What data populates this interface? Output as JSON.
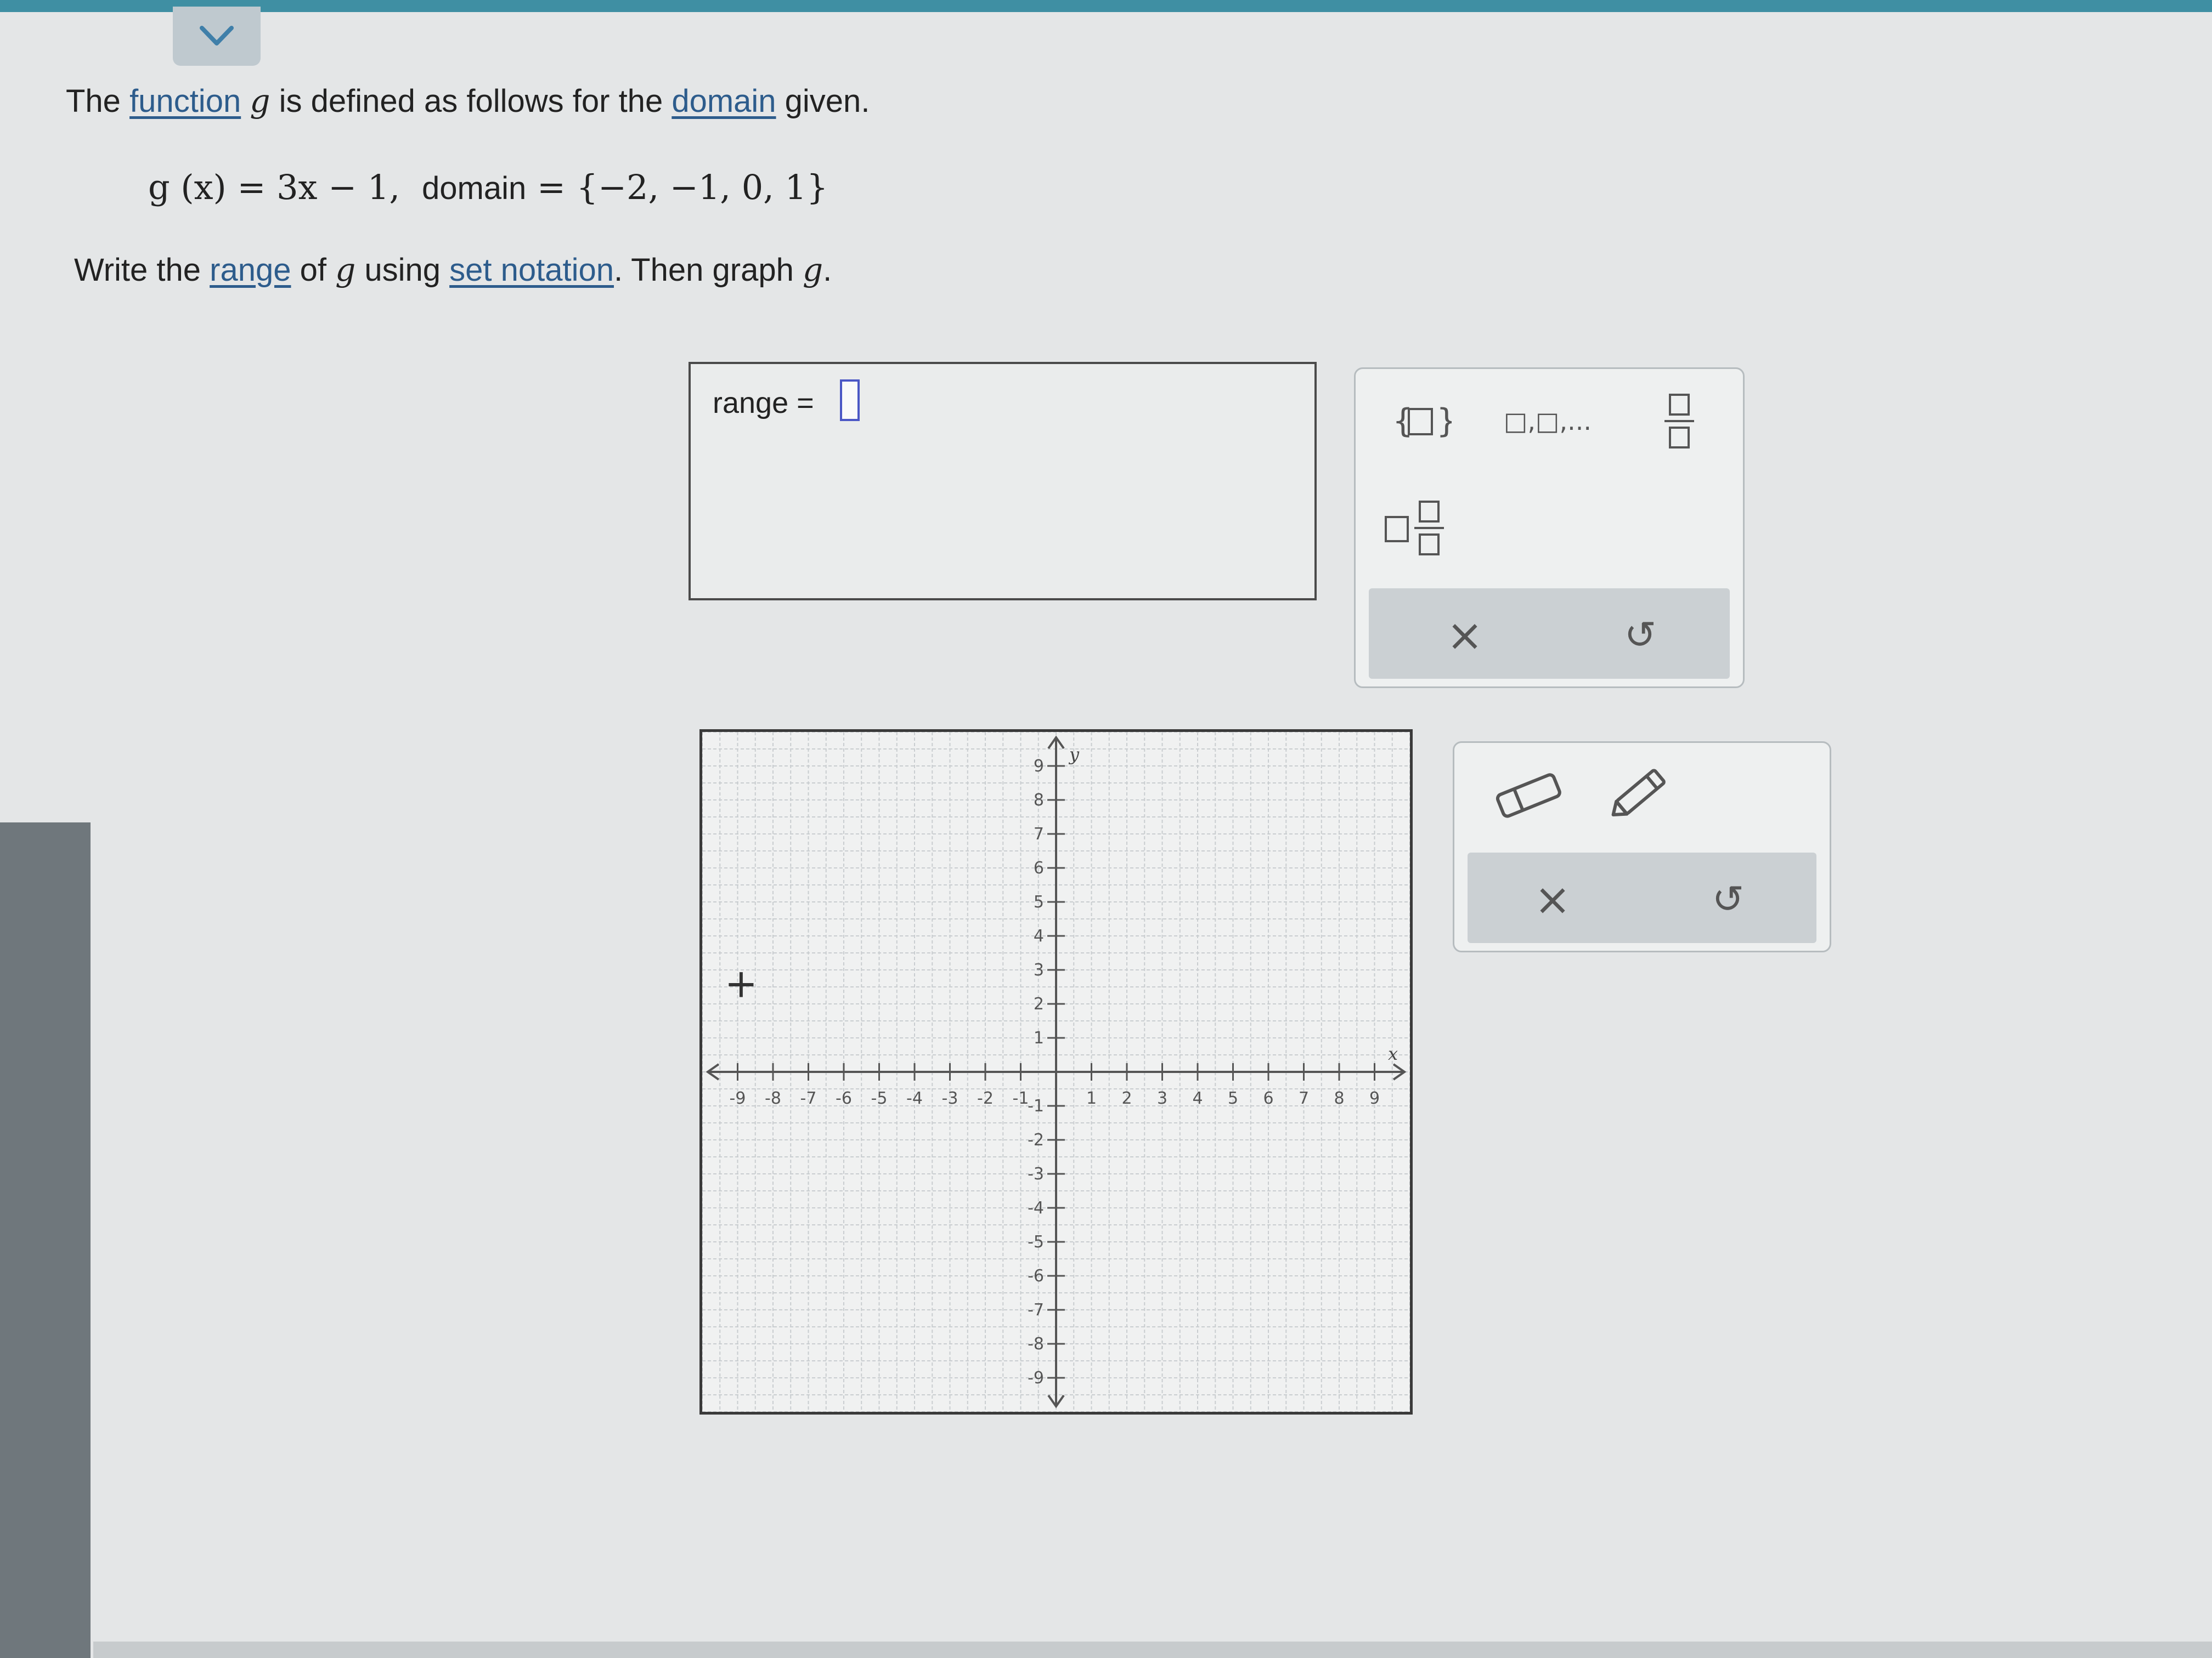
{
  "problem": {
    "line1": {
      "pre": "The ",
      "function_link": "function",
      "g": "g",
      "mid": " is defined as follows for the ",
      "domain_link": "domain",
      "post": " given."
    },
    "line2": {
      "formula": "g (x) = 3x − 1,",
      "domain_label": "domain",
      "domain_value": "= {−2, −1, 0, 1}"
    },
    "line3": {
      "pre": "Write the ",
      "range_link": "range",
      "mid1": " of ",
      "g": "g",
      "mid2": " using ",
      "set_notation_link": "set notation",
      "post": ". Then graph ",
      "g2": "g",
      "end": "."
    }
  },
  "answer": {
    "label": "range ="
  },
  "palette_math": {
    "buttons": [
      "set-braces",
      "list-comma",
      "fraction",
      "mixed-number"
    ],
    "list_label": "□,□,...",
    "clear_symbol": "×",
    "undo_symbol": "↺"
  },
  "palette_graph": {
    "buttons": [
      "eraser",
      "pencil"
    ],
    "clear_symbol": "×",
    "undo_symbol": "↺"
  },
  "graph": {
    "x_label": "x",
    "y_label": "y",
    "x_ticks": [
      "-9",
      "-8",
      "-7",
      "-6",
      "-5",
      "-4",
      "-3",
      "-2",
      "-1",
      "1",
      "2",
      "3",
      "4",
      "5",
      "6",
      "7",
      "8",
      "9"
    ],
    "y_ticks": [
      "9",
      "8",
      "7",
      "6",
      "5",
      "4",
      "3",
      "2",
      "1",
      "-1",
      "-2",
      "-3",
      "-4",
      "-5",
      "-6",
      "-7",
      "-8",
      "-9"
    ],
    "xlim": [
      -10,
      10
    ],
    "ylim": [
      -10,
      10
    ],
    "crosshair": "+"
  }
}
